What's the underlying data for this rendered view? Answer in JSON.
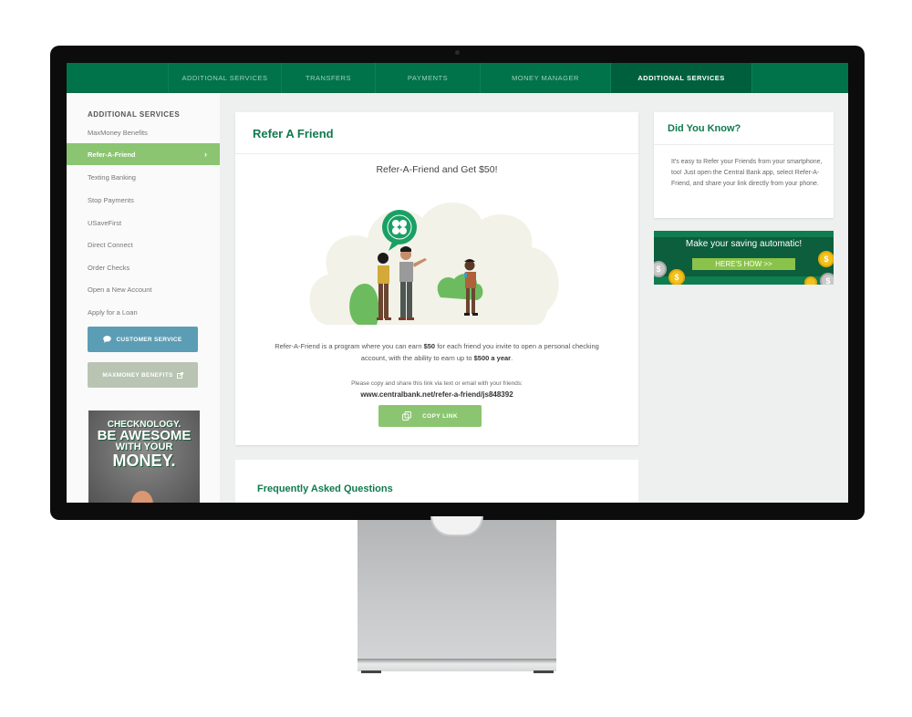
{
  "topnav": {
    "items": [
      {
        "label": "ADDITIONAL SERVICES",
        "active": false
      },
      {
        "label": "TRANSFERS",
        "active": false
      },
      {
        "label": "PAYMENTS",
        "active": false
      },
      {
        "label": "MONEY MANAGER",
        "active": false
      },
      {
        "label": "ADDITIONAL SERVICES",
        "active": true
      }
    ]
  },
  "sidebar": {
    "heading": "ADDITIONAL SERVICES",
    "items": [
      {
        "label": "MaxMoney Benefits"
      },
      {
        "label": "Refer-A-Friend",
        "active": true
      },
      {
        "label": "Texting Banking"
      },
      {
        "label": "Stop Payments"
      },
      {
        "label": "USaveFirst"
      },
      {
        "label": "Direct Connect"
      },
      {
        "label": "Order Checks"
      },
      {
        "label": "Open a New Account"
      },
      {
        "label": "Apply for a Loan"
      }
    ],
    "active_chevron": "›",
    "customer_service_label": "CUSTOMER SERVICE",
    "maxmoney_label": "MAXMONEY BENEFITS",
    "ad": {
      "line1": "CHECKNOLOGY.",
      "line2": "BE AWESOME",
      "line3": "WITH YOUR",
      "line4": "MONEY."
    }
  },
  "main": {
    "title": "Refer A Friend",
    "subheading": "Refer-A-Friend and Get $50!",
    "description": {
      "part1": "Refer-A-Friend is a program where you can earn ",
      "amount1": "$50",
      "part2": " for each friend you invite to open a personal checking account, with the ability to earn up to ",
      "amount2": "$500 a year",
      "part3": "."
    },
    "share_note": "Please copy and share this link via text or email with your friends:",
    "share_link": "www.centralbank.net/refer-a-friend/js848392",
    "copy_button": "COPY LINK"
  },
  "faq": {
    "title": "Frequently Asked Questions"
  },
  "did_you_know": {
    "title": "Did You Know?",
    "text": "It's easy to Refer your Friends from your smartphone, too! Just open the Central Bank app, select Refer-A-Friend, and share your link directly from your phone."
  },
  "save_ad": {
    "headline": "Make your saving automatic!",
    "cta": "HERE'S HOW >>",
    "coin_symbol": "$"
  },
  "colors": {
    "brand_green": "#00734b",
    "accent_green": "#8bc571",
    "title_green": "#107a4e",
    "customer_service_blue": "#5b9db4",
    "maxmoney_gray": "#b9c4b3"
  }
}
